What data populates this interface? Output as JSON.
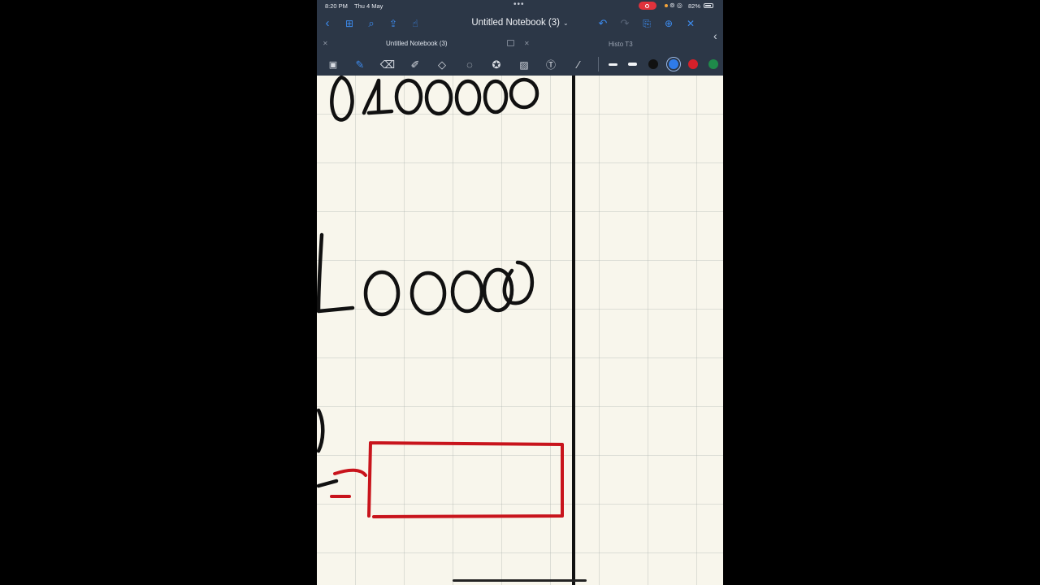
{
  "status": {
    "time": "8:20 PM",
    "date": "Thu 4 May",
    "battery": "82%"
  },
  "nav": {
    "title": "Untitled Notebook (3)",
    "chevron": "⌄",
    "icons": [
      "back-icon",
      "grid-icon",
      "search-icon",
      "share-icon",
      "touch-icon",
      "undo-icon",
      "redo-icon",
      "bookmark-icon",
      "add-page-icon",
      "close-icon"
    ]
  },
  "tabs": [
    {
      "label": "Untitled Notebook (3)",
      "active": true
    },
    {
      "label": "Histo T3",
      "active": false
    }
  ],
  "toolbar": {
    "tools": [
      "image-text-icon",
      "pen-icon",
      "eraser-icon",
      "highlighter-icon",
      "shapes-icon",
      "lasso-icon",
      "sticker-icon",
      "image-icon",
      "text-icon",
      "laser-icon"
    ],
    "active_tool": "pen-icon",
    "colors": [
      "#111111",
      "#2f7be8",
      "#d6202a",
      "#1f8a4a"
    ],
    "selected_color": "#2f7be8"
  },
  "accent_color": "#3d8cf0",
  "canvas": {
    "paper": "#f8f6ec",
    "ink_black": "#111111",
    "ink_red": "#c8141c"
  }
}
